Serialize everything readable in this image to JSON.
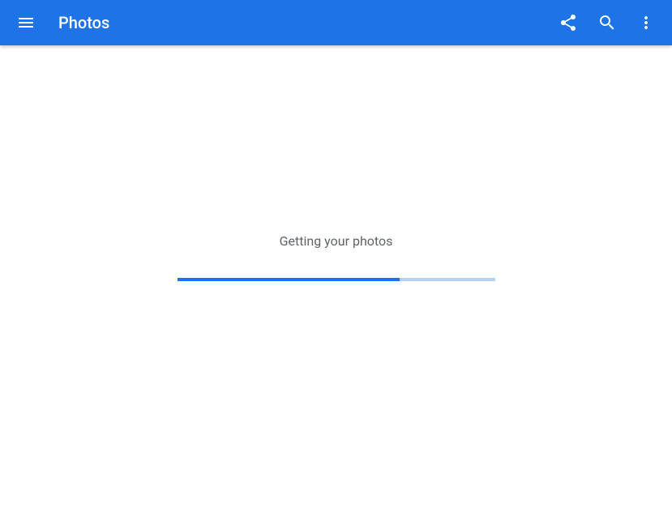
{
  "header": {
    "title": "Photos"
  },
  "main": {
    "loading_text": "Getting your photos",
    "progress_percent": 70
  },
  "colors": {
    "app_bar_bg": "#1e73e6",
    "progress_fill": "#1a73e8",
    "progress_track": "#b3d1f5"
  }
}
